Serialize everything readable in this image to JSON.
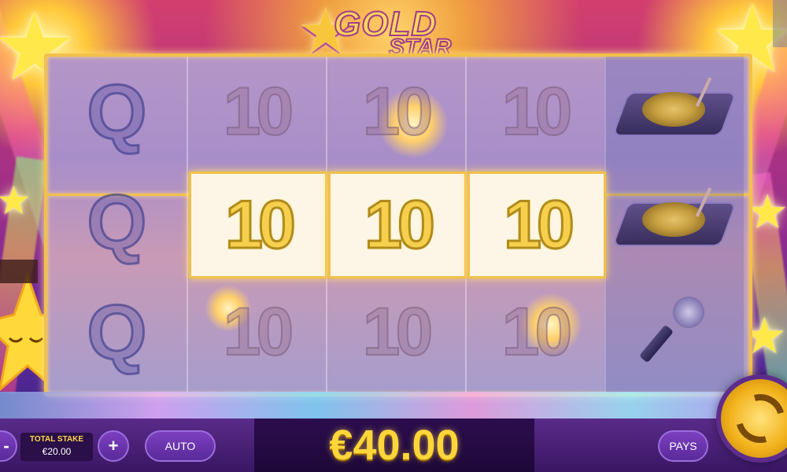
{
  "logo": {
    "word1": "GOLD",
    "word2": "STAR"
  },
  "reels": {
    "columns": [
      [
        "Q",
        "Q",
        "Q"
      ],
      [
        "10",
        "10",
        "10"
      ],
      [
        "10",
        "10",
        "10"
      ],
      [
        "10",
        "10",
        "10"
      ],
      [
        "turntable",
        "turntable",
        "microphone"
      ]
    ],
    "winning_row": 2,
    "winning_columns": [
      2,
      3,
      4
    ]
  },
  "controls": {
    "minus_label": "-",
    "stake_label": "TOTAL STAKE",
    "stake_value": "€20.00",
    "plus_label": "+",
    "auto_label": "AUTO",
    "win_amount": "€40.00",
    "pays_label": "PAYS",
    "spin_icon": "spin-arrows-icon"
  },
  "colors": {
    "accent_gold": "#ffd63a",
    "panel_purple": "#3a1664"
  }
}
